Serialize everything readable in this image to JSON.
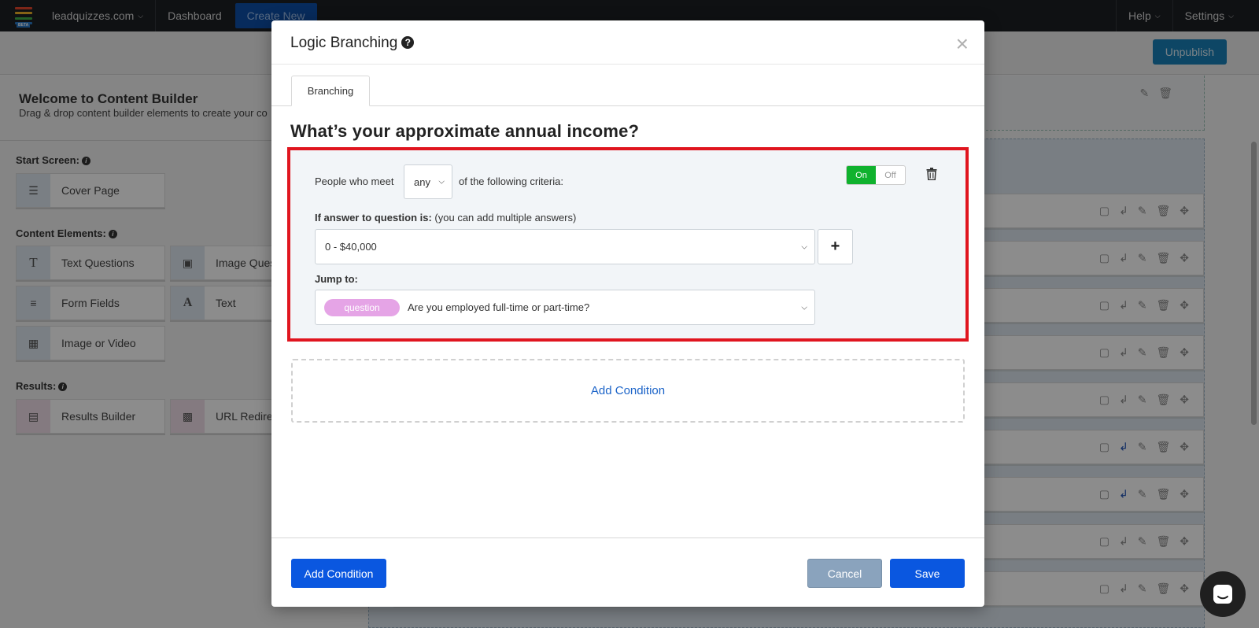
{
  "topbar": {
    "site": "leadquizzes.com",
    "dashboard": "Dashboard",
    "create_new": "Create New",
    "beta": "BETA",
    "help": "Help",
    "settings": "Settings"
  },
  "subbar": {
    "unpublish": "Unpublish"
  },
  "left_panel": {
    "welcome_title": "Welcome to Content Builder",
    "welcome_subtitle": "Drag & drop content builder elements to create your co",
    "start_screen_label": "Start Screen:",
    "start_items": [
      {
        "label": "Cover Page",
        "icon": "align-center-icon"
      }
    ],
    "content_elements_label": "Content Elements:",
    "content_items": [
      {
        "label": "Text Questions",
        "icon": "text-t-icon"
      },
      {
        "label": "Image Ques",
        "icon": "image-icon"
      },
      {
        "label": "Form Fields",
        "icon": "form-icon"
      },
      {
        "label": "Text",
        "icon": "letter-a-icon"
      },
      {
        "label": "Image or Video",
        "icon": "file-media-icon"
      }
    ],
    "results_label": "Results:",
    "result_items": [
      {
        "label": "Results Builder",
        "icon": "document-icon"
      },
      {
        "label": "URL Redirec",
        "icon": "monitor-icon"
      }
    ]
  },
  "modal": {
    "title": "Logic Branching",
    "tab_label": "Branching",
    "question_title": "What’s your approximate annual income?",
    "criteria": {
      "prefix": "People who meet",
      "match_value": "any",
      "suffix": "of the following criteria:",
      "toggle_on": "On",
      "toggle_off": "Off",
      "answer_label_bold": "If answer to question is:",
      "answer_label_hint": "(you can add multiple answers)",
      "answer_value": "0 - $40,000",
      "add_answer": "+",
      "jump_label": "Jump to:",
      "jump_tag": "question",
      "jump_value": "Are you employed full-time or part-time?"
    },
    "add_condition_dashed": "Add Condition",
    "footer": {
      "add_condition": "Add Condition",
      "cancel": "Cancel",
      "save": "Save"
    }
  },
  "colors": {
    "highlight_border": "#e0151f",
    "primary_blue": "#0a57e0",
    "toggle_on": "#10b22e",
    "tag_pill": "#e5a4e6"
  }
}
